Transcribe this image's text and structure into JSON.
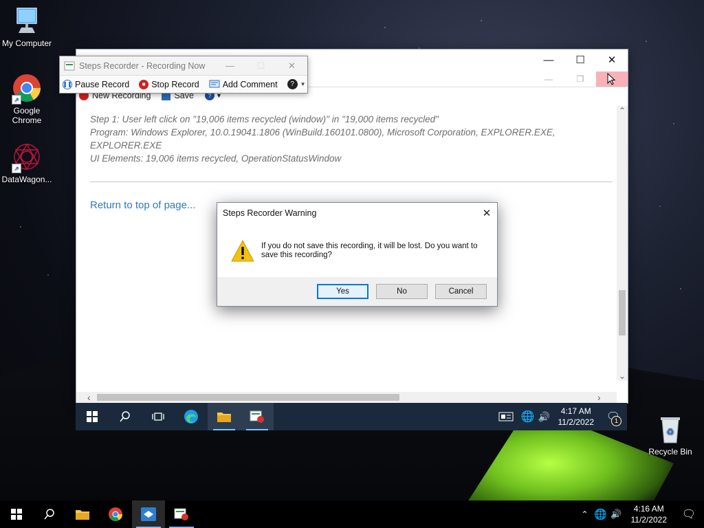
{
  "desktop": {
    "icons": [
      {
        "label": "My Computer"
      },
      {
        "label": "Google Chrome"
      },
      {
        "label": "DataWagon..."
      },
      {
        "label": "Recycle Bin"
      }
    ]
  },
  "recorder_toolbar": {
    "title": "Steps Recorder - Recording Now",
    "pause": "Pause Record",
    "stop": "Stop Record",
    "comment": "Add Comment"
  },
  "main_window": {
    "under_toolbar": {
      "new_recording": "New Recording",
      "save": "Save"
    },
    "step_line": "Step 1: User left click on \"19,006 items recycled (window)\" in \"19,000 items recycled\"",
    "program_line": "Program: Windows Explorer, 10.0.19041.1806 (WinBuild.160101.0800), Microsoft Corporation, EXPLORER.EXE, EXPLORER.EXE",
    "ui_elements_line": "UI Elements: 19,006 items recycled, OperationStatusWindow",
    "return_link": "Return to top of page..."
  },
  "inner_taskbar": {
    "time": "4:17 AM",
    "date": "11/2/2022",
    "notification_count": "1"
  },
  "dialog": {
    "title": "Steps Recorder Warning",
    "message": "If you do not save this recording, it will be lost. Do you want to save this recording?",
    "buttons": {
      "yes": "Yes",
      "no": "No",
      "cancel": "Cancel"
    }
  },
  "taskbar": {
    "time": "4:16 AM",
    "date": "11/2/2022"
  },
  "colors": {
    "link": "#2e7ab5",
    "accent": "#0078d7"
  }
}
